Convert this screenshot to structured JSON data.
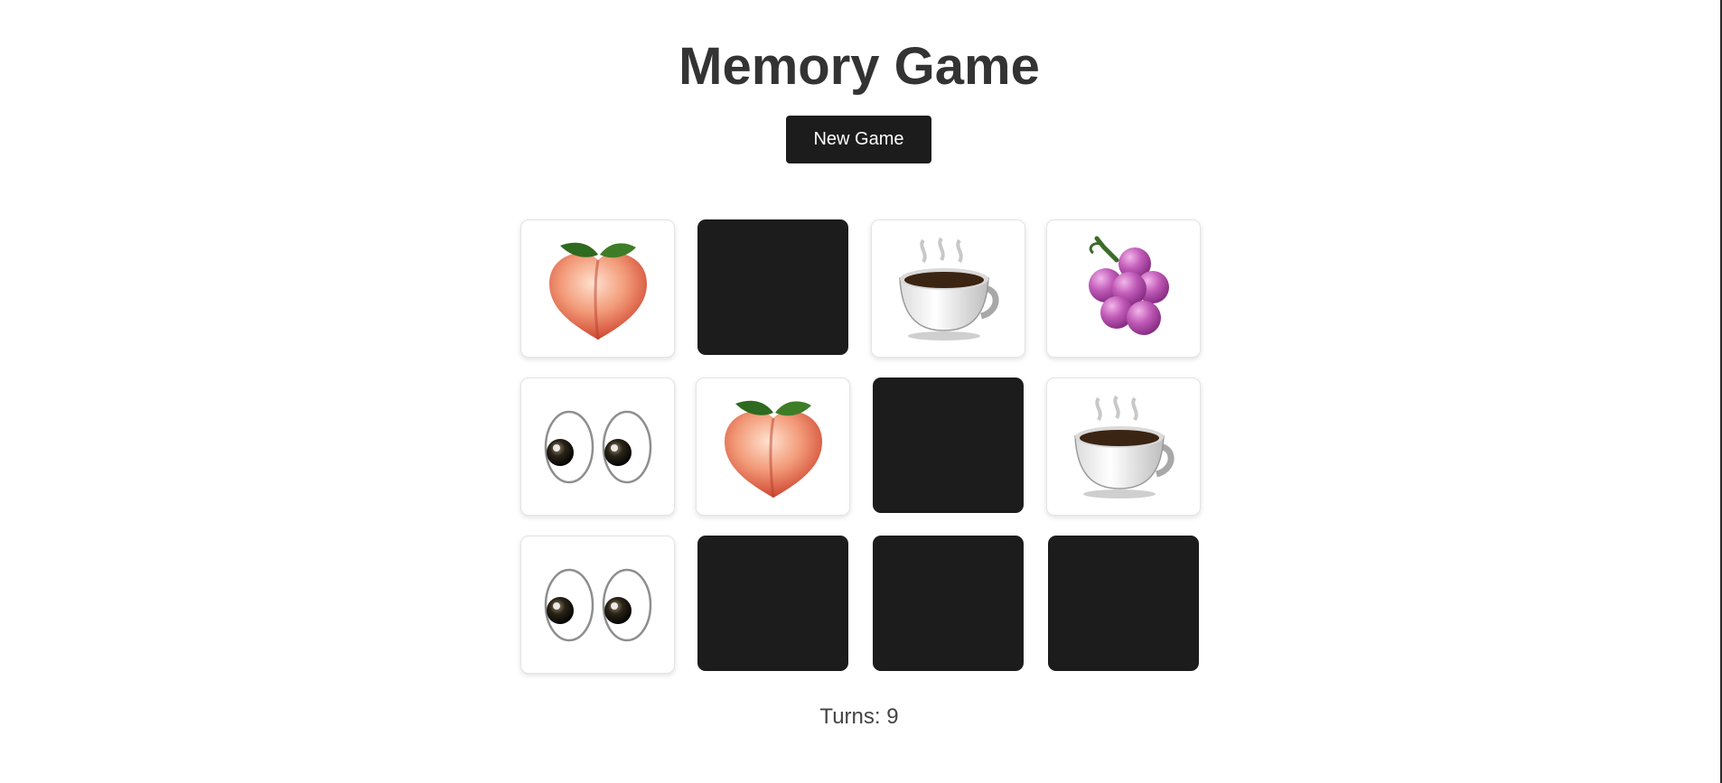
{
  "title": "Memory Game",
  "new_game_label": "New Game",
  "turns_label": "Turns: 9",
  "card_back_color": "#1c1c1c",
  "cards": [
    {
      "state": "face-up",
      "icon": "peach-icon"
    },
    {
      "state": "face-down",
      "icon": ""
    },
    {
      "state": "face-up",
      "icon": "coffee-icon"
    },
    {
      "state": "face-up",
      "icon": "grapes-icon"
    },
    {
      "state": "face-up",
      "icon": "eyes-icon"
    },
    {
      "state": "face-up",
      "icon": "peach-icon"
    },
    {
      "state": "face-down",
      "icon": ""
    },
    {
      "state": "face-up",
      "icon": "coffee-icon"
    },
    {
      "state": "face-up",
      "icon": "eyes-icon"
    },
    {
      "state": "face-down",
      "icon": ""
    },
    {
      "state": "face-down",
      "icon": ""
    },
    {
      "state": "face-down",
      "icon": ""
    }
  ]
}
